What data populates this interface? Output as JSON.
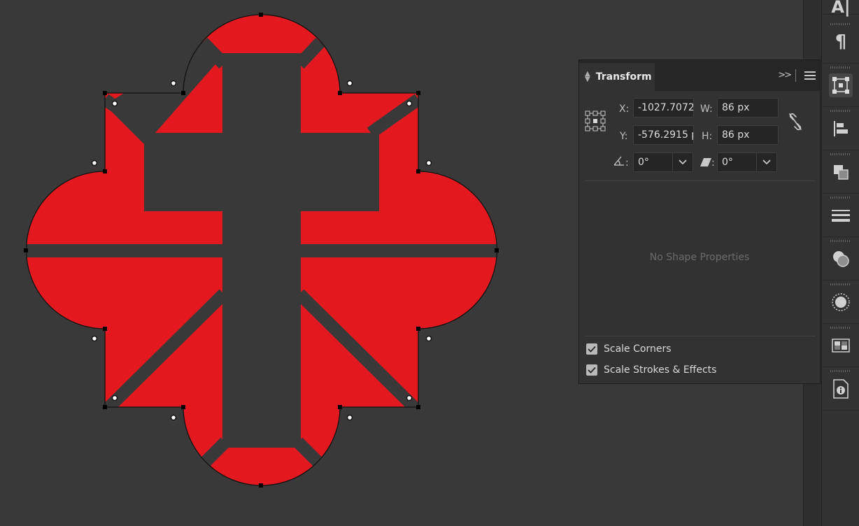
{
  "dock": {
    "top_text": "A|",
    "items": [
      {
        "icon": "paragraph-icon"
      },
      {
        "icon": "transform-icon",
        "active": true
      },
      {
        "icon": "align-icon"
      },
      {
        "icon": "pathfinder-icon"
      },
      {
        "icon": "stroke-icon"
      },
      {
        "icon": "transparency-icon"
      },
      {
        "icon": "appearance-icon"
      },
      {
        "icon": "swatches-icon"
      },
      {
        "icon": "document-info-icon"
      }
    ],
    "paragraph_glyph": "¶"
  },
  "transform": {
    "title": "Transform",
    "expand_glyph": ">>",
    "x_label": "X:",
    "x_value": "-1027.7072",
    "y_label": "Y:",
    "y_value": "-576.2915 p",
    "w_label": "W:",
    "w_value": "86 px",
    "h_label": "H:",
    "h_value": "86 px",
    "rotate_label": ":",
    "rotate_value": "0°",
    "shear_label": ":",
    "shear_value": "0°",
    "no_shape": "No Shape Properties",
    "scale_corners": "Scale Corners",
    "scale_strokes": "Scale Strokes & Effects",
    "scale_corners_checked": true,
    "scale_strokes_checked": true
  },
  "colors": {
    "canvas": "#393939",
    "shape_fill": "#e4191f",
    "cross": "#393939"
  }
}
